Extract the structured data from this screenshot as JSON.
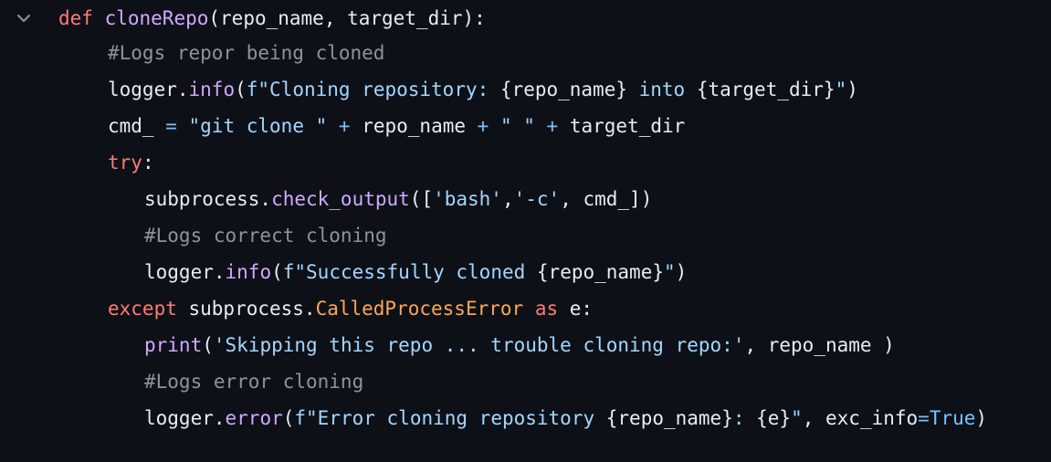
{
  "colors": {
    "background": "#0d1117",
    "keyword": "#ff7b72",
    "function": "#d2a8ff",
    "string": "#a5d6ff",
    "comment": "#8b949e",
    "operator": "#79c0ff",
    "class": "#ffa657",
    "text": "#e6edf3"
  },
  "fold_icon": "chevron-down-icon",
  "lines": [
    [
      {
        "t": "def",
        "c": "kw"
      },
      {
        "t": " ",
        "c": "txt"
      },
      {
        "t": "cloneRepo",
        "c": "fn"
      },
      {
        "t": "(repo_name, target_dir):",
        "c": "txt"
      }
    ],
    [
      {
        "t": "#Logs repor being cloned",
        "c": "cmt"
      }
    ],
    [
      {
        "t": "logger.",
        "c": "txt"
      },
      {
        "t": "info",
        "c": "fn"
      },
      {
        "t": "(",
        "c": "txt"
      },
      {
        "t": "f\"Cloning repository: ",
        "c": "str"
      },
      {
        "t": "{repo_name}",
        "c": "txt"
      },
      {
        "t": " into ",
        "c": "str"
      },
      {
        "t": "{target_dir}",
        "c": "txt"
      },
      {
        "t": "\"",
        "c": "str"
      },
      {
        "t": ")",
        "c": "txt"
      }
    ],
    [
      {
        "t": "cmd_ ",
        "c": "txt"
      },
      {
        "t": "=",
        "c": "op"
      },
      {
        "t": " ",
        "c": "txt"
      },
      {
        "t": "\"git clone \"",
        "c": "str"
      },
      {
        "t": " ",
        "c": "txt"
      },
      {
        "t": "+",
        "c": "op"
      },
      {
        "t": " repo_name ",
        "c": "txt"
      },
      {
        "t": "+",
        "c": "op"
      },
      {
        "t": " ",
        "c": "txt"
      },
      {
        "t": "\" \"",
        "c": "str"
      },
      {
        "t": " ",
        "c": "txt"
      },
      {
        "t": "+",
        "c": "op"
      },
      {
        "t": " target_dir",
        "c": "txt"
      }
    ],
    [
      {
        "t": "try",
        "c": "kw"
      },
      {
        "t": ":",
        "c": "txt"
      }
    ],
    [
      {
        "t": "subprocess.",
        "c": "txt"
      },
      {
        "t": "check_output",
        "c": "fn"
      },
      {
        "t": "([",
        "c": "txt"
      },
      {
        "t": "'bash'",
        "c": "str"
      },
      {
        "t": ",",
        "c": "txt"
      },
      {
        "t": "'-c'",
        "c": "str"
      },
      {
        "t": ", cmd_])",
        "c": "txt"
      }
    ],
    [
      {
        "t": "#Logs correct cloning",
        "c": "cmt"
      }
    ],
    [
      {
        "t": "logger.",
        "c": "txt"
      },
      {
        "t": "info",
        "c": "fn"
      },
      {
        "t": "(",
        "c": "txt"
      },
      {
        "t": "f\"Successfully cloned ",
        "c": "str"
      },
      {
        "t": "{repo_name}",
        "c": "txt"
      },
      {
        "t": "\"",
        "c": "str"
      },
      {
        "t": ")",
        "c": "txt"
      }
    ],
    [
      {
        "t": "except",
        "c": "kw"
      },
      {
        "t": " subprocess.",
        "c": "txt"
      },
      {
        "t": "CalledProcessError",
        "c": "cls"
      },
      {
        "t": " ",
        "c": "txt"
      },
      {
        "t": "as",
        "c": "kw"
      },
      {
        "t": " e:",
        "c": "txt"
      }
    ],
    [
      {
        "t": "print",
        "c": "fn"
      },
      {
        "t": "(",
        "c": "txt"
      },
      {
        "t": "'Skipping this repo ... trouble cloning repo:'",
        "c": "str"
      },
      {
        "t": ", repo_name )",
        "c": "txt"
      }
    ],
    [
      {
        "t": "#Logs error cloning",
        "c": "cmt"
      }
    ],
    [
      {
        "t": "logger.",
        "c": "txt"
      },
      {
        "t": "error",
        "c": "fn"
      },
      {
        "t": "(",
        "c": "txt"
      },
      {
        "t": "f\"Error cloning repository ",
        "c": "str"
      },
      {
        "t": "{repo_name}",
        "c": "txt"
      },
      {
        "t": ": ",
        "c": "str"
      },
      {
        "t": "{e}",
        "c": "txt"
      },
      {
        "t": "\"",
        "c": "str"
      },
      {
        "t": ", exc_info",
        "c": "txt"
      },
      {
        "t": "=",
        "c": "op"
      },
      {
        "t": "True",
        "c": "op"
      },
      {
        "t": ")",
        "c": "txt"
      }
    ]
  ]
}
